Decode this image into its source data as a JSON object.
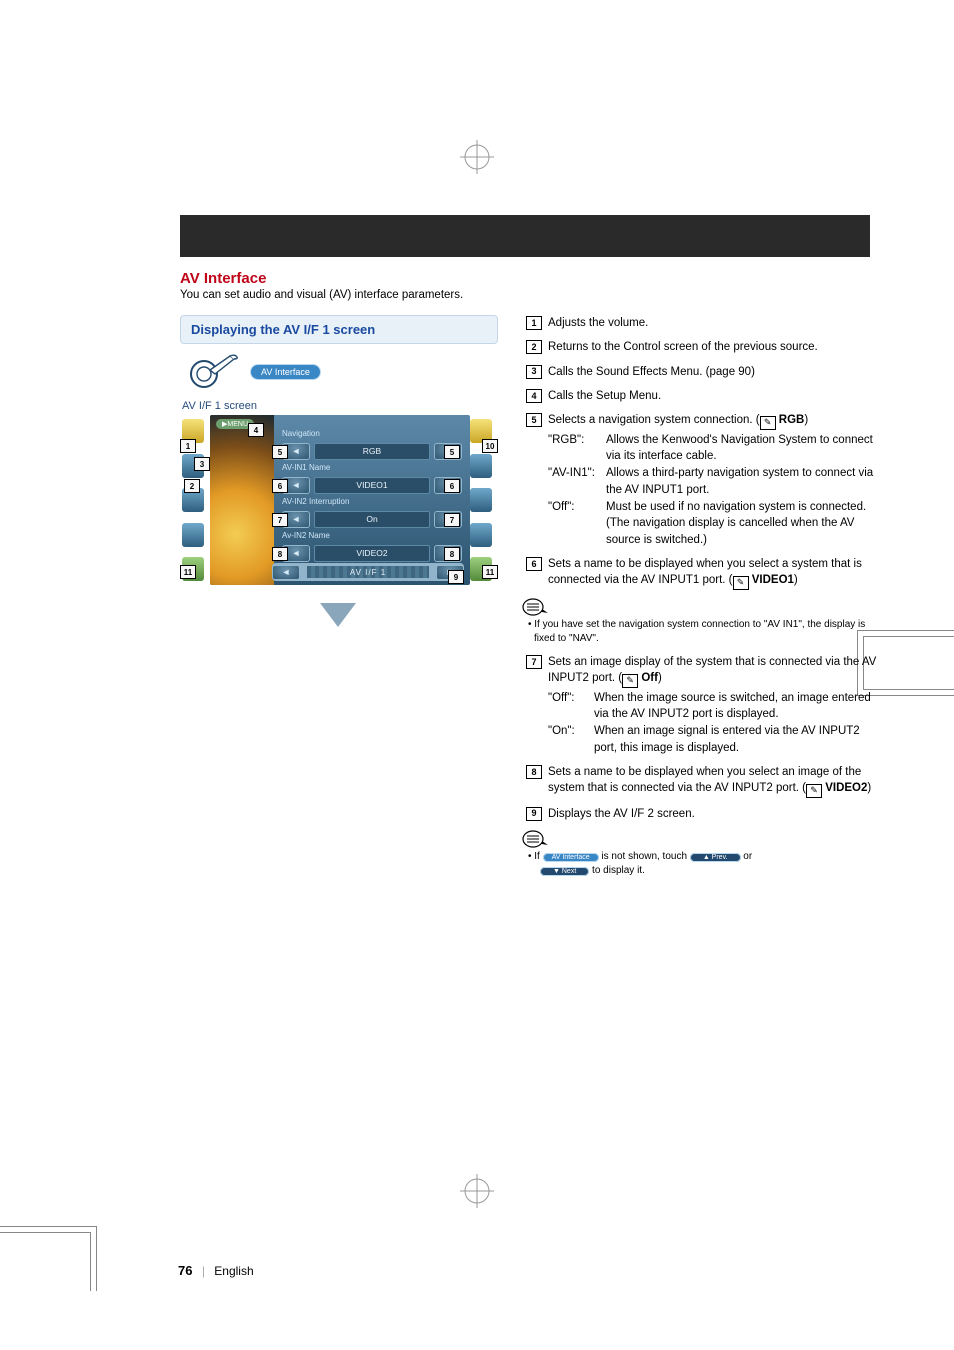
{
  "header": {
    "band": ""
  },
  "section": {
    "title": "AV Interface",
    "intro": "You can set audio and visual (AV) interface parameters."
  },
  "bluebox": {
    "title": "Displaying the AV I/F 1 screen"
  },
  "breadcrumb": {
    "pill": "AV Interface"
  },
  "screen_label": "AV I/F 1 screen",
  "device": {
    "menu": "▶MENU",
    "rows": [
      {
        "label": "Navigation",
        "value": "RGB"
      },
      {
        "label": "AV-IN1 Name",
        "value": "VIDEO1"
      },
      {
        "label": "AV-IN2 Interruption",
        "value": "On"
      },
      {
        "label": "Av-IN2 Name",
        "value": "VIDEO2"
      }
    ],
    "tab": "AV I/F 1"
  },
  "callouts": {
    "c1": "1",
    "c2": "2",
    "c3": "3",
    "c4": "4",
    "c5": "5",
    "c6": "6",
    "c7": "7",
    "c8": "8",
    "c9": "9",
    "c10": "10",
    "c11": "11"
  },
  "items": {
    "i1": "Adjusts the volume.",
    "i2": "Returns to the Control screen of the previous source.",
    "i3": "Calls the Sound Effects Menu. (page 90)",
    "i4": "Calls the Setup Menu.",
    "i5": {
      "lead": "Selects a navigation system connection. (",
      "default": " RGB",
      "tail": ")",
      "defs": [
        {
          "term": "\"RGB\":",
          "desc": "Allows the Kenwood's Navigation System to connect via its interface cable."
        },
        {
          "term": "\"AV-IN1\":",
          "desc": "Allows a third-party navigation system to connect via the AV INPUT1 port."
        },
        {
          "term": "\"Off\":",
          "desc": "Must be used if no navigation system is connected. (The navigation display is cancelled when the AV source is switched.)"
        }
      ]
    },
    "i6": {
      "lead": "Sets a name to be displayed when you select a system that is connected via the AV INPUT1 port. (",
      "default": " VIDEO1",
      "tail": ")"
    },
    "note6": "If you have set the navigation system connection to \"AV IN1\", the display is fixed to \"NAV\".",
    "i7": {
      "lead": "Sets an image display of the system that is connected via the AV INPUT2 port. (",
      "default": " Off",
      "tail": ")",
      "defs": [
        {
          "term": "\"Off\":",
          "desc": "When the image source is switched, an image entered via the AV INPUT2 port is displayed."
        },
        {
          "term": "\"On\":",
          "desc": "When an image signal is entered via the AV INPUT2 port, this image is displayed."
        }
      ]
    },
    "i8": {
      "lead": "Sets a name to be displayed when you select an image of the system that is connected via the AV INPUT2 port. (",
      "default": " VIDEO2",
      "tail": ")"
    },
    "i9": "Displays the AV I/F 2 screen."
  },
  "note_bottom": {
    "pre": "If ",
    "pill1": "AV Interface",
    "mid": " is not shown, touch ",
    "pill2": "▲ Prev.",
    "mid2": " or ",
    "pill3": "▼ Next",
    "post": " to display it."
  },
  "footer": {
    "page": "76",
    "lang": "English"
  }
}
